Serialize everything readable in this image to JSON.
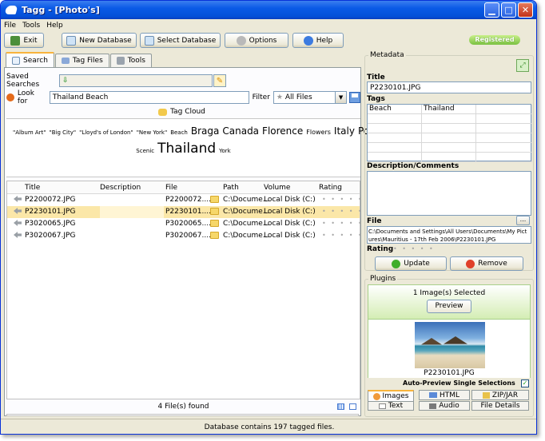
{
  "window": {
    "title": "Tagg - [Photo's]"
  },
  "menu": [
    "File",
    "Tools",
    "Help"
  ],
  "toolbar": {
    "exit": "Exit",
    "new_database": "New Database",
    "select_database": "Select Database",
    "options": "Options",
    "help": "Help",
    "registered": "Registered"
  },
  "tabs": [
    "Search",
    "Tag Files",
    "Tools"
  ],
  "search": {
    "saved_searches_label": "Saved Searches",
    "look_for_label": "Look for",
    "look_for_value": "Thailand Beach",
    "filter_label": "Filter",
    "filter_value": "All Files"
  },
  "tag_cloud": {
    "header": "Tag Cloud",
    "tags": [
      {
        "text": "\"Album Art\"",
        "size": 7
      },
      {
        "text": "\"Big City\"",
        "size": 7
      },
      {
        "text": "\"Lloyd's of London\"",
        "size": 7
      },
      {
        "text": "\"New York\"",
        "size": 7
      },
      {
        "text": "Beach",
        "size": 7
      },
      {
        "text": "Braga",
        "size": 12
      },
      {
        "text": "Canada",
        "size": 12
      },
      {
        "text": "Florence",
        "size": 12
      },
      {
        "text": "Flowers",
        "size": 8
      },
      {
        "text": "Italy",
        "size": 12
      },
      {
        "text": "Portugal",
        "size": 12
      },
      {
        "text": "Scenic",
        "size": 7
      },
      {
        "text": "Thailand",
        "size": 17
      },
      {
        "text": "York",
        "size": 7
      }
    ]
  },
  "file_list": {
    "columns": [
      "Title",
      "Description",
      "File",
      "Path",
      "Volume",
      "Rating"
    ],
    "rows": [
      {
        "title": "P2200072.JPG",
        "description": "",
        "file": "P2200072....",
        "path": "C:\\Docume...",
        "volume": "Local Disk (C:)",
        "rating": "• • • • •",
        "selected": false
      },
      {
        "title": "P2230101.JPG",
        "description": "",
        "file": "P2230101....",
        "path": "C:\\Docume...",
        "volume": "Local Disk (C:)",
        "rating": "• • • • •",
        "selected": true
      },
      {
        "title": "P3020065.JPG",
        "description": "",
        "file": "P3020065....",
        "path": "C:\\Docume...",
        "volume": "Local Disk (C:)",
        "rating": "• • • • •",
        "selected": false
      },
      {
        "title": "P3020067.JPG",
        "description": "",
        "file": "P3020067....",
        "path": "C:\\Docume...",
        "volume": "Local Disk (C:)",
        "rating": "• • • • •",
        "selected": false
      }
    ],
    "footer": "4 File(s) found"
  },
  "status": "Database contains 197 tagged files.",
  "metadata": {
    "legend": "Metadata",
    "title_label": "Title",
    "title_value": "P2230101.JPG",
    "tags_label": "Tags",
    "tags": [
      "Beach",
      "Thailand"
    ],
    "description_label": "Description/Comments",
    "file_label": "File",
    "file_browse": "...",
    "file_path": "C:\\Documents and Settings\\All Users\\Documents\\My Pictures\\Mauritius - 17th Feb 2006\\P2230101.JPG",
    "rating_label": "Rating",
    "rating": "• • • • •",
    "update": "Update",
    "remove": "Remove"
  },
  "plugins": {
    "legend": "Plugins",
    "selected_text": "1 Image(s) Selected",
    "preview": "Preview",
    "image_caption": "P2230101.JPG",
    "auto_preview": "Auto-Preview Single Selections",
    "tabs_row1": [
      "Images",
      "HTML",
      "ZIP/JAR"
    ],
    "tabs_row2": [
      "Text",
      "Audio",
      "File Details"
    ]
  }
}
